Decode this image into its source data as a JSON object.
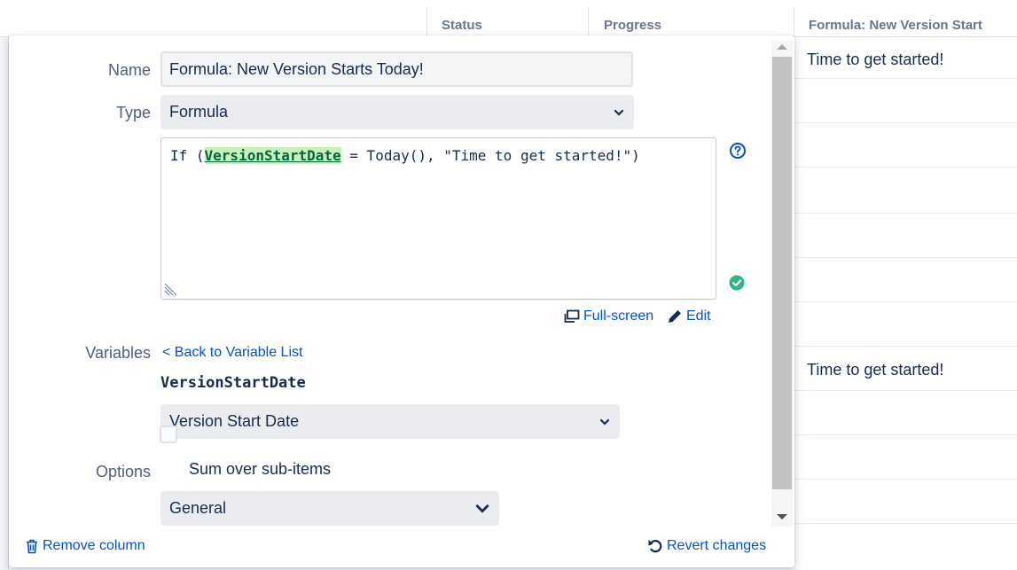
{
  "grid": {
    "headers": [
      "Status",
      "Progress",
      "Formula: New Version Start"
    ],
    "cells": [
      "Time to get started!",
      "Time to get started!"
    ]
  },
  "editor": {
    "name_label": "Name",
    "name_value": "Formula: New Version Starts Today!",
    "type_label": "Type",
    "type_value": "Formula",
    "formula_prefix": "If (",
    "formula_variable": "VersionStartDate",
    "formula_suffix": " = Today(), \"Time to get started!\")",
    "fullscreen_label": "Full-screen",
    "edit_label": "Edit",
    "variables_label": "Variables",
    "back_link": "< Back to Variable List",
    "variable_name": "VersionStartDate",
    "variable_mapping": "Version Start Date",
    "options_label": "Options",
    "sum_label": "Sum over sub-items",
    "format_value": "General",
    "remove_label": "Remove column",
    "revert_label": "Revert changes"
  },
  "colors": {
    "link": "#0052cc",
    "valid": "#36b37e",
    "highlight": "#c9f0b8"
  }
}
